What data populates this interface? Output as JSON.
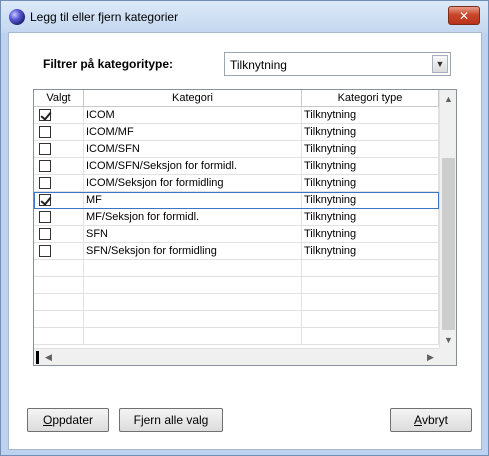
{
  "window": {
    "title": "Legg til eller fjern kategorier",
    "close_label": "✕"
  },
  "filter": {
    "label": "Filtrer på kategoritype:",
    "selected": "Tilknytning"
  },
  "grid": {
    "columns": [
      "Valgt",
      "Kategori",
      "Kategori type"
    ],
    "rows": [
      {
        "checked": true,
        "kategori": "ICOM",
        "type": "Tilknytning"
      },
      {
        "checked": false,
        "kategori": "ICOM/MF",
        "type": "Tilknytning"
      },
      {
        "checked": false,
        "kategori": "ICOM/SFN",
        "type": "Tilknytning"
      },
      {
        "checked": false,
        "kategori": "ICOM/SFN/Seksjon for formidl.",
        "type": "Tilknytning"
      },
      {
        "checked": false,
        "kategori": "ICOM/Seksjon for formidling",
        "type": "Tilknytning"
      },
      {
        "checked": true,
        "kategori": "MF",
        "type": "Tilknytning",
        "selected": true
      },
      {
        "checked": false,
        "kategori": "MF/Seksjon for formidl.",
        "type": "Tilknytning"
      },
      {
        "checked": false,
        "kategori": "SFN",
        "type": "Tilknytning"
      },
      {
        "checked": false,
        "kategori": "SFN/Seksjon for formidling",
        "type": "Tilknytning"
      }
    ],
    "empty_rows": 5
  },
  "buttons": {
    "update_first": "O",
    "update_rest": "ppdater",
    "clear": "Fjern alle valg",
    "cancel_first": "A",
    "cancel_rest": "vbryt"
  }
}
